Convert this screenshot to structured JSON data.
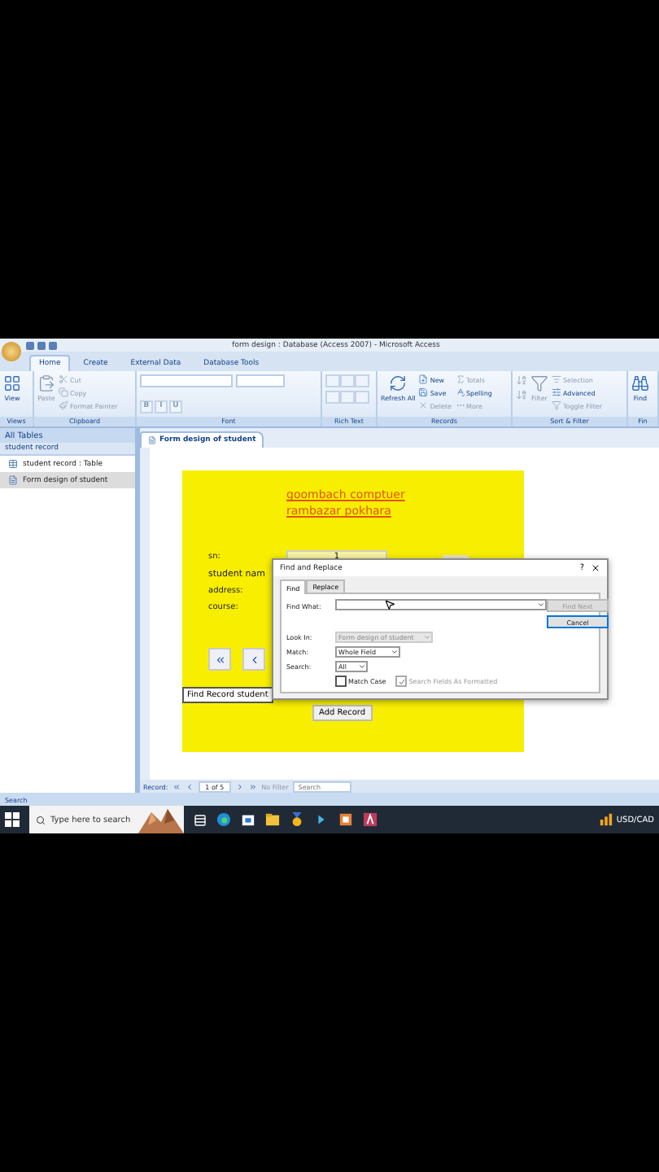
{
  "title_bar": {
    "title": "form design : Database (Access 2007) - Microsoft Access"
  },
  "ribbon_tabs": [
    {
      "label": "Home",
      "selected": true
    },
    {
      "label": "Create",
      "selected": false
    },
    {
      "label": "External Data",
      "selected": false
    },
    {
      "label": "Database Tools",
      "selected": false
    }
  ],
  "ribbon_groups": [
    {
      "label": "Views",
      "items": [
        {
          "kind": "large",
          "label": "View",
          "disabled": false
        }
      ]
    },
    {
      "label": "Clipboard",
      "items": [
        {
          "kind": "large",
          "label": "Paste",
          "disabled": true
        },
        {
          "kind": "small",
          "label": "Cut",
          "disabled": true
        },
        {
          "kind": "small",
          "label": "Copy",
          "disabled": true
        },
        {
          "kind": "small",
          "label": "Format Painter",
          "disabled": true
        }
      ]
    },
    {
      "label": "Font",
      "items": [
        {
          "kind": "dropdown"
        },
        {
          "kind": "format",
          "label": "B",
          "disabled": true
        },
        {
          "kind": "format",
          "label": "I",
          "disabled": true
        },
        {
          "kind": "format",
          "label": "U",
          "disabled": true
        }
      ]
    },
    {
      "label": "Rich Text",
      "items": [
        {
          "kind": "lines"
        }
      ]
    },
    {
      "label": "Records",
      "items": [
        {
          "kind": "large",
          "label": "Refresh All",
          "disabled": false
        },
        {
          "kind": "small",
          "label": "New",
          "disabled": false
        },
        {
          "kind": "small",
          "label": "Save",
          "disabled": false
        },
        {
          "kind": "small",
          "label": "Delete",
          "disabled": true
        },
        {
          "kind": "small",
          "label": "Totals",
          "disabled": true
        },
        {
          "kind": "small",
          "label": "Spelling",
          "disabled": false
        },
        {
          "kind": "small",
          "label": "More",
          "disabled": true
        }
      ]
    },
    {
      "label": "Sort & Filter",
      "items": [
        {
          "kind": "sort"
        },
        {
          "kind": "large",
          "label": "Filter",
          "disabled": true
        },
        {
          "kind": "small",
          "label": "Selection",
          "disabled": true
        },
        {
          "kind": "small",
          "label": "Advanced",
          "disabled": false
        },
        {
          "kind": "small",
          "label": "Toggle Filter",
          "disabled": true
        }
      ]
    },
    {
      "label": "Fin",
      "items": [
        {
          "kind": "large",
          "label": "Find",
          "disabled": false
        }
      ]
    }
  ],
  "nav_pane": {
    "header": "All Tables",
    "group": "student record",
    "items": [
      {
        "label": "student record : Table",
        "kind": "table",
        "selected": false
      },
      {
        "label": "Form design of student",
        "kind": "form",
        "selected": true
      }
    ]
  },
  "document_tab": {
    "label": "Form design of student"
  },
  "form": {
    "headings": [
      "goombach comptuer",
      "rambazar pokhara"
    ],
    "fields": [
      {
        "label": "sn:",
        "value": "1",
        "kind": "small"
      },
      {
        "label": "student nam",
        "kind": "large"
      },
      {
        "label": "address:",
        "kind": "small"
      },
      {
        "label": "course:",
        "kind": "small"
      }
    ],
    "find_button": "Find Record student",
    "add_button": "Add Record"
  },
  "dialog": {
    "title": "Find and Replace",
    "help": "?",
    "tabs": [
      {
        "label": "Find",
        "selected": true
      },
      {
        "label": "Replace",
        "selected": false
      }
    ],
    "find_what_label": "Find What:",
    "find_next": "Find Next",
    "find_next_disabled": true,
    "cancel": "Cancel",
    "look_in_label": "Look In:",
    "look_in": "Form design of student",
    "match_label": "Match:",
    "match": "Whole Field",
    "search_label": "Search:",
    "search": "All",
    "checks": [
      {
        "label": "Match Case",
        "checked": false,
        "disabled": false
      },
      {
        "label": "Search Fields As Formatted",
        "checked": true,
        "disabled": true
      }
    ]
  },
  "record_bar": {
    "label": "Record:",
    "position": "1 of 5",
    "filter": "No Filter",
    "search_placeholder": "Search"
  },
  "status_bar": {
    "text": "Search"
  },
  "taskbar": {
    "search_placeholder": "Type here to search",
    "tray_text": "USD/CAD"
  }
}
